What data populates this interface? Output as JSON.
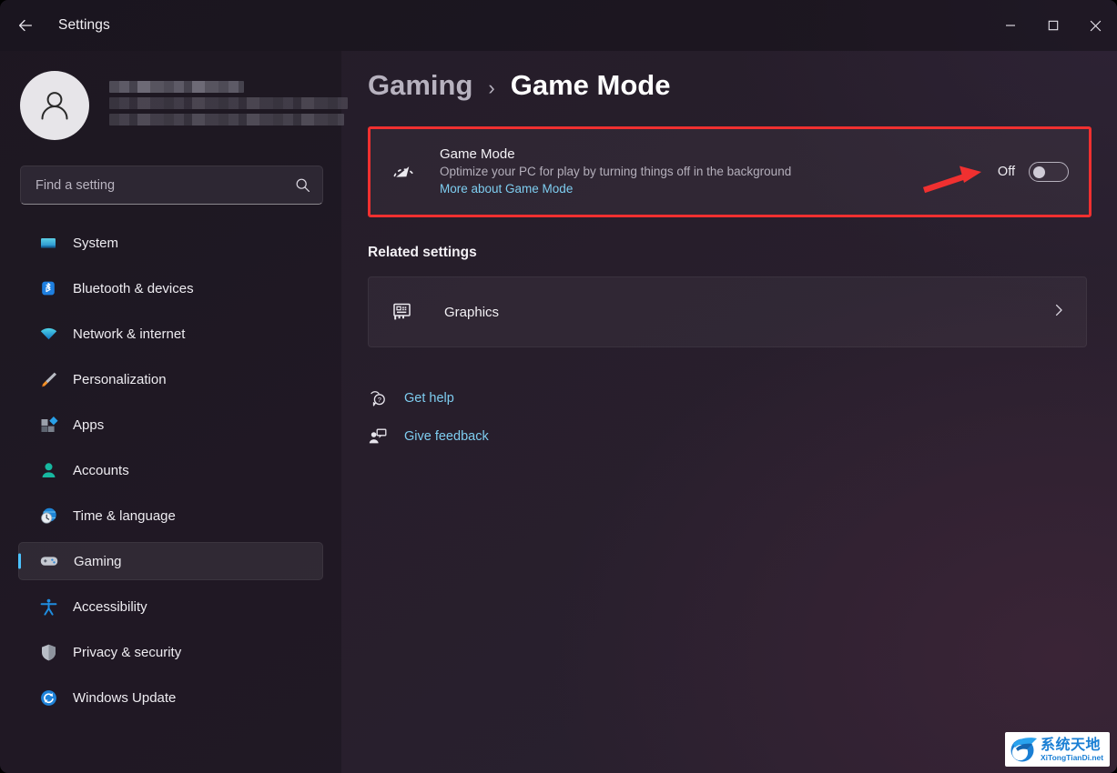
{
  "window": {
    "title": "Settings",
    "back_icon": "back-arrow-icon",
    "minimize_label": "—",
    "maximize_label": "□",
    "close_label": "✕"
  },
  "sidebar": {
    "account": {
      "avatar_icon": "person-avatar-icon",
      "name_redacted": "",
      "email_redacted": ""
    },
    "search": {
      "placeholder": "Find a setting",
      "value": "",
      "icon": "search-icon"
    },
    "items": [
      {
        "label": "System",
        "icon": "monitor-icon",
        "active": false
      },
      {
        "label": "Bluetooth & devices",
        "icon": "bluetooth-icon",
        "active": false
      },
      {
        "label": "Network & internet",
        "icon": "wifi-icon",
        "active": false
      },
      {
        "label": "Personalization",
        "icon": "paintbrush-icon",
        "active": false
      },
      {
        "label": "Apps",
        "icon": "apps-icon",
        "active": false
      },
      {
        "label": "Accounts",
        "icon": "account-icon",
        "active": false
      },
      {
        "label": "Time & language",
        "icon": "clock-globe-icon",
        "active": false
      },
      {
        "label": "Gaming",
        "icon": "gamepad-icon",
        "active": true
      },
      {
        "label": "Accessibility",
        "icon": "accessibility-icon",
        "active": false
      },
      {
        "label": "Privacy & security",
        "icon": "shield-icon",
        "active": false
      },
      {
        "label": "Windows Update",
        "icon": "update-icon",
        "active": false
      }
    ]
  },
  "main": {
    "breadcrumb": {
      "parent": "Gaming",
      "separator": "›",
      "current": "Game Mode"
    },
    "game_mode": {
      "icon": "speedometer-icon",
      "title": "Game Mode",
      "description": "Optimize your PC for play by turning things off in the background",
      "link": "More about Game Mode",
      "toggle_state": "Off",
      "toggle_on": false,
      "highlight_color": "#f03030"
    },
    "related_settings": {
      "heading": "Related settings",
      "rows": [
        {
          "label": "Graphics",
          "icon": "graphics-card-icon",
          "chevron": "chevron-right-icon"
        }
      ]
    },
    "footer_links": [
      {
        "label": "Get help",
        "icon": "help-icon"
      },
      {
        "label": "Give feedback",
        "icon": "feedback-icon"
      }
    ]
  },
  "annotations": {
    "arrow": {
      "color": "#f03030",
      "points_to": "toggle-state"
    }
  },
  "watermark": {
    "cn_text": "系统天地",
    "en_text": "XiTongTianDi.net",
    "accent": "#1a7fd4"
  }
}
